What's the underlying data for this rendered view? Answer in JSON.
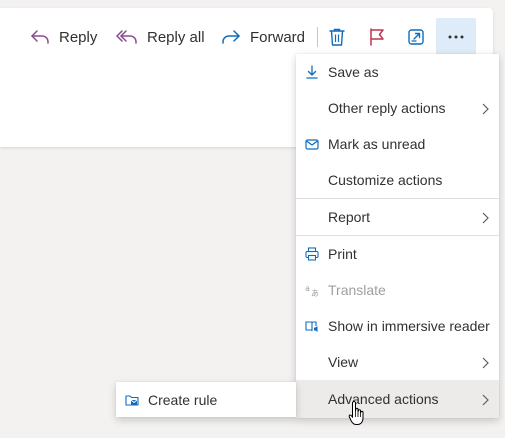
{
  "toolbar": {
    "reply_label": "Reply",
    "reply_all_label": "Reply all",
    "forward_label": "Forward",
    "delete_icon": "trash-icon",
    "flag_icon": "flag-icon",
    "popout_icon": "popout-icon",
    "more_icon": "more-ellipsis-icon"
  },
  "menu": {
    "items": [
      {
        "label": "Save as",
        "icon": "download-icon"
      },
      {
        "label": "Other reply actions",
        "submenu": true
      },
      {
        "label": "Mark as unread",
        "icon": "envelope-icon"
      },
      {
        "label": "Customize actions"
      },
      {
        "label": "Report",
        "submenu": true
      },
      {
        "label": "Print",
        "icon": "printer-icon"
      },
      {
        "label": "Translate",
        "icon": "translate-icon",
        "disabled": true
      },
      {
        "label": "Show in immersive reader",
        "icon": "immersive-reader-icon"
      },
      {
        "label": "View",
        "submenu": true
      },
      {
        "label": "Advanced actions",
        "submenu": true,
        "highlighted": true
      }
    ]
  },
  "submenu": {
    "items": [
      {
        "label": "Create rule",
        "icon": "folder-rule-icon"
      }
    ]
  },
  "colors": {
    "reply_icon": "#8a4a8f",
    "forward_icon": "#0f6cbd",
    "flag_icon": "#c4314b",
    "accent": "#0078d4",
    "more_bg": "#deecf9",
    "highlight_bg": "#edebe9"
  }
}
